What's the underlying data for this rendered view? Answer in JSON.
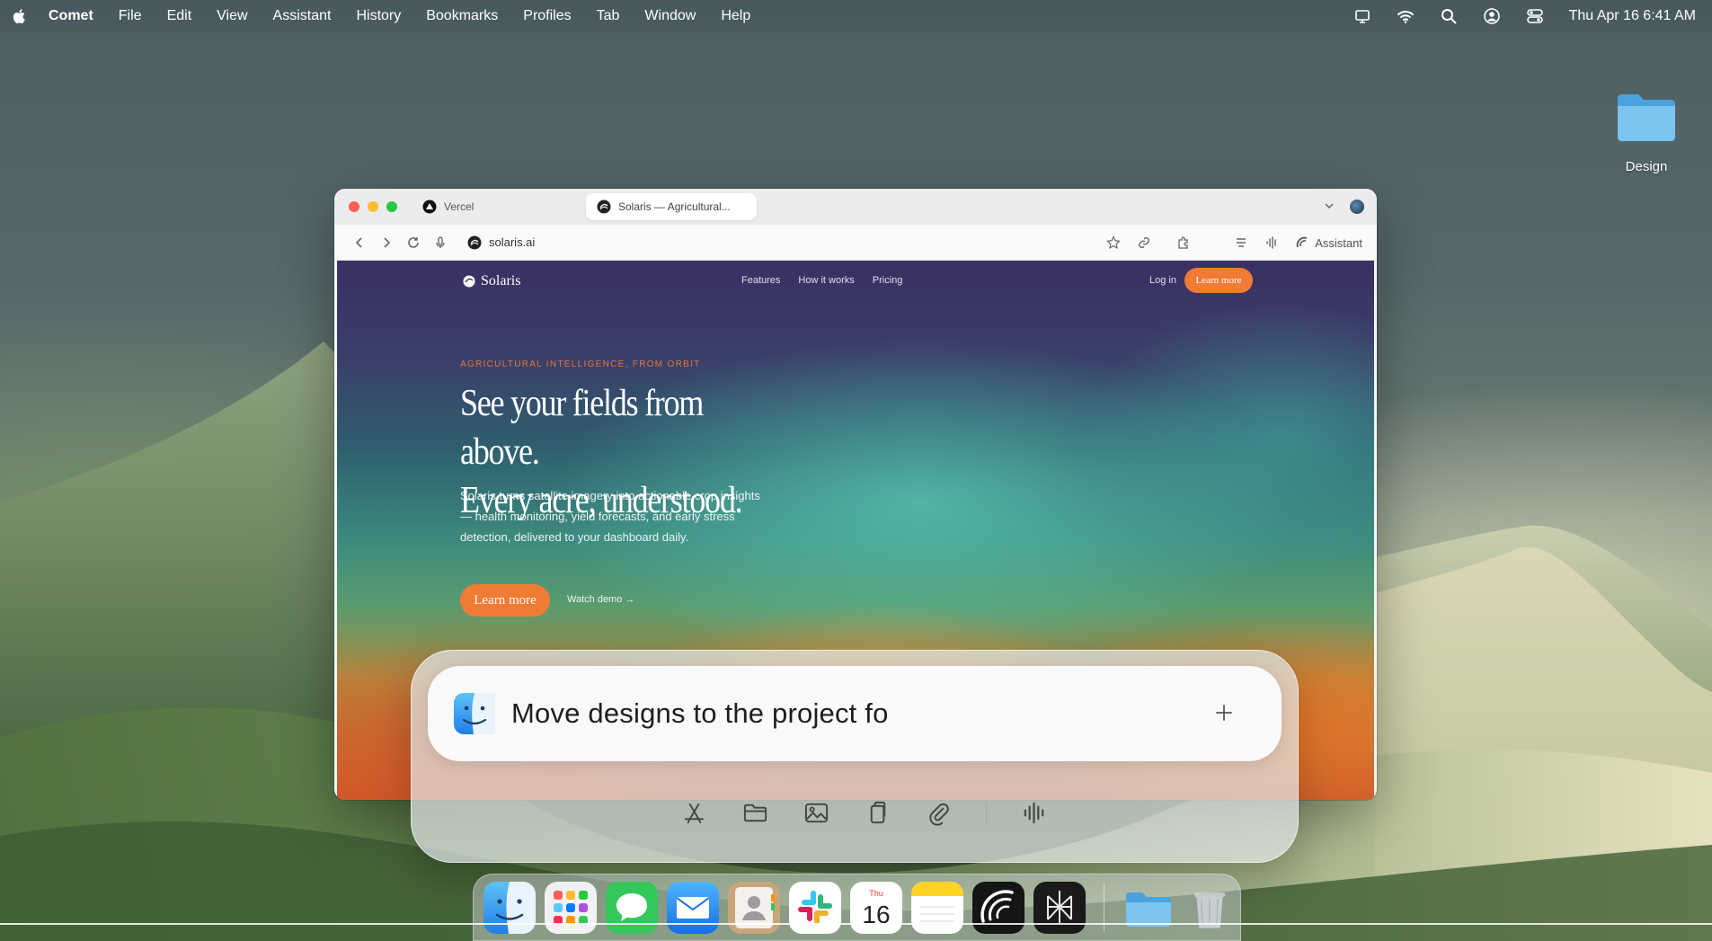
{
  "menubar": {
    "app_name": "Comet",
    "items": [
      "File",
      "Edit",
      "View",
      "Assistant",
      "History",
      "Bookmarks",
      "Profiles",
      "Tab",
      "Window",
      "Help"
    ],
    "status_icons": [
      "display-icon",
      "wifi-icon",
      "search-icon",
      "user-icon",
      "control-center-icon"
    ],
    "clock": "Thu Apr 16  6:41 AM"
  },
  "desktop": {
    "folders": [
      {
        "label": "Design"
      }
    ]
  },
  "browser": {
    "tabs": [
      {
        "title": "Vercel",
        "active": false
      },
      {
        "title": "Solaris — Agricultural...",
        "active": true
      }
    ],
    "url": "solaris.ai",
    "assistant_label": "Assistant"
  },
  "site": {
    "logo": "Solaris",
    "nav_links": [
      "Features",
      "How it works",
      "Pricing"
    ],
    "login": "Log in",
    "nav_cta": "Learn more",
    "eyebrow": "AGRICULTURAL INTELLIGENCE, FROM ORBIT",
    "hero_line1": "See your fields from above.",
    "hero_line2": "Every acre, understood.",
    "hero_sub": "Solaris turns satellite imagery into actionable crop insights — health monitoring, yield forecasts, and early stress detection, delivered to your dashboard daily.",
    "hero_cta": "Learn more",
    "watch_demo": "Watch demo →",
    "colors": {
      "accent": "#f07b35",
      "eyebrow": "#e2763a"
    }
  },
  "assistant_bar": {
    "query": "Move designs to the project fo",
    "actions": [
      "app-store-icon",
      "folder-icon",
      "image-icon",
      "clipboard-icon",
      "paperclip-icon",
      "voice-icon"
    ]
  },
  "dock": {
    "apps": [
      "Finder",
      "Launchpad",
      "Messages",
      "Mail",
      "Contacts",
      "Slack",
      "Calendar",
      "Notes",
      "Comet",
      "Perplexity"
    ],
    "calendar_day": "Thu",
    "calendar_date": "16",
    "extras": [
      "Downloads",
      "Trash"
    ]
  }
}
